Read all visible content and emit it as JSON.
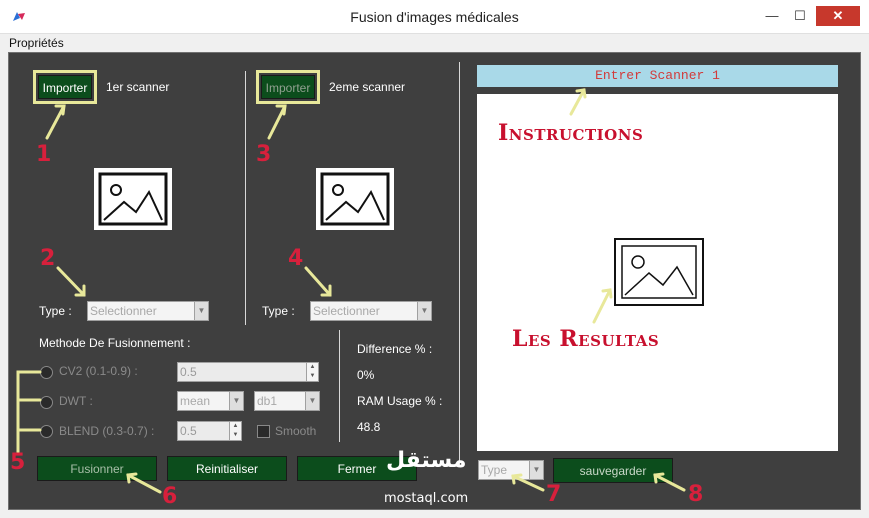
{
  "window": {
    "title": "Fusion  d'images médicales",
    "controls": {
      "minimize": "—",
      "maximize": "☐",
      "close": "✕"
    }
  },
  "menu": {
    "items": [
      "Propriétés"
    ]
  },
  "scanner1": {
    "import_label": "Importer",
    "caption": "1er scanner",
    "type_label": "Type :",
    "type_value": "Selectionner"
  },
  "scanner2": {
    "import_label": "Importer",
    "caption": "2eme scanner",
    "type_label": "Type :",
    "type_value": "Selectionner"
  },
  "fusion": {
    "heading": "Methode De Fusionnement :",
    "options": [
      {
        "label": "CV2 (0.1-0.9) :",
        "value": "0.5"
      },
      {
        "label": "DWT :",
        "wavelet_mode": "mean",
        "wavelet": "db1"
      },
      {
        "label": "BLEND (0.3-0.7) :",
        "value": "0.5",
        "smooth_label": "Smooth"
      }
    ]
  },
  "stats": {
    "difference_label": "Difference % :",
    "difference_value": "0%",
    "ram_label": "RAM Usage % :",
    "ram_value": "48.8"
  },
  "actions": {
    "fuse": "Fusionner",
    "reset": "Reinitialiser",
    "close": "Fermer"
  },
  "result": {
    "instruction": "Entrer Scanner 1",
    "type_placeholder": "Type",
    "save": "sauvegarder"
  },
  "annotations": {
    "numbers": [
      "1",
      "2",
      "3",
      "4",
      "5",
      "6",
      "7",
      "8"
    ],
    "instructions": "Instructions",
    "results": "Les Resultas"
  },
  "watermark": {
    "arabic": "مستقل",
    "latin": "mostaql.com"
  },
  "colors": {
    "panel": "#3f3f3f",
    "button_green": "#0c4d1c",
    "annotation_red": "#d7203c",
    "arrow_yellow": "#e8e89a",
    "instruction_bg": "#a9d9e8"
  }
}
